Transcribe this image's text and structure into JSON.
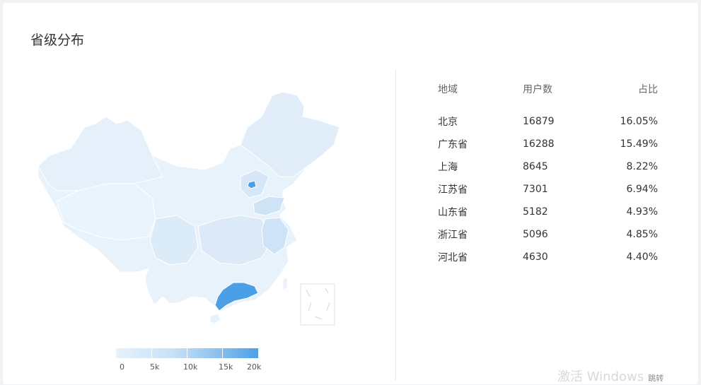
{
  "panel": {
    "title": "省级分布"
  },
  "table": {
    "headers": [
      "地域",
      "用户数",
      "占比"
    ],
    "rows": [
      [
        "北京",
        "16879",
        "16.05%"
      ],
      [
        "广东省",
        "16288",
        "15.49%"
      ],
      [
        "上海",
        "8645",
        "8.22%"
      ],
      [
        "江苏省",
        "7301",
        "6.94%"
      ],
      [
        "山东省",
        "5182",
        "4.93%"
      ],
      [
        "浙江省",
        "5096",
        "4.85%"
      ],
      [
        "河北省",
        "4630",
        "4.40%"
      ]
    ]
  },
  "legend": {
    "labels": [
      "0",
      "5k",
      "10k",
      "15k",
      "20k"
    ],
    "color_min": "#e6f2fc",
    "color_max": "#4aa0e8"
  },
  "map": {
    "highlight_color": "#4a9fe6",
    "base_color": "#e3effa",
    "highlighted": [
      "北京",
      "广东省"
    ]
  },
  "watermark": {
    "text": "激活 Windows",
    "small": "跳转"
  }
}
